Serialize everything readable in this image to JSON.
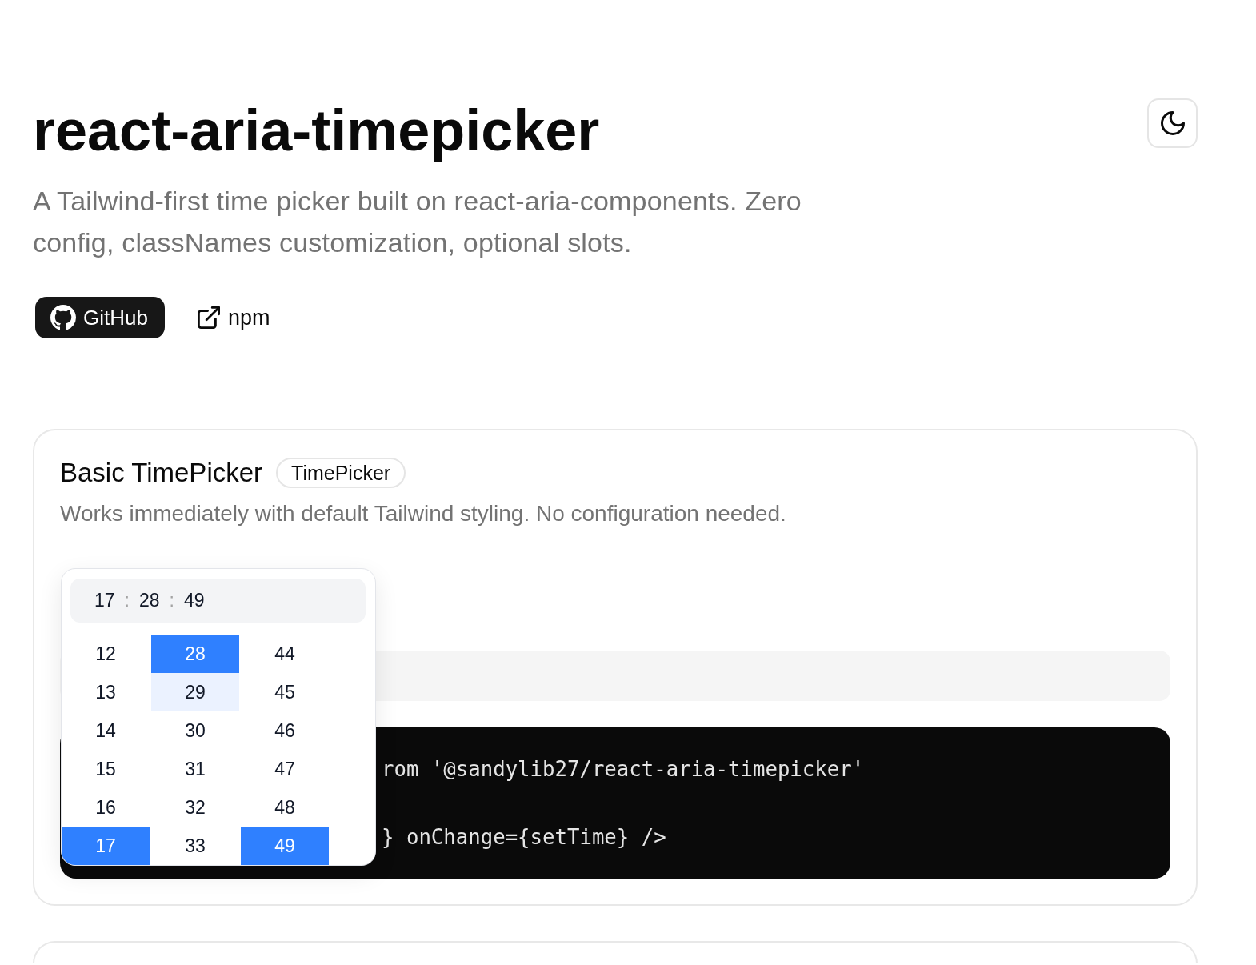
{
  "header": {
    "title": "react-aria-timepicker",
    "description": "A Tailwind-first time picker built on react-aria-components. Zero config, classNames customization, optional slots.",
    "links": [
      {
        "kind": "primary",
        "label": "GitHub"
      },
      {
        "kind": "external",
        "label": "npm"
      }
    ]
  },
  "demos": [
    {
      "title": "Basic TimePicker",
      "badge": "TimePicker",
      "description": "Works immediately with default Tailwind styling. No configuration needed.",
      "time_picker": {
        "segments": [
          {
            "kind": "value",
            "text": "17"
          },
          {
            "kind": "separator",
            "text": ":"
          },
          {
            "kind": "value",
            "text": "28"
          },
          {
            "kind": "separator",
            "text": ":"
          },
          {
            "kind": "value",
            "text": "49"
          }
        ],
        "columns": [
          {
            "items": [
              {
                "label": "12",
                "selected": false,
                "hovered": false
              },
              {
                "label": "13",
                "selected": false,
                "hovered": false
              },
              {
                "label": "14",
                "selected": false,
                "hovered": false
              },
              {
                "label": "15",
                "selected": false,
                "hovered": false
              },
              {
                "label": "16",
                "selected": false,
                "hovered": false
              },
              {
                "label": "17",
                "selected": true,
                "hovered": false
              }
            ]
          },
          {
            "items": [
              {
                "label": "28",
                "selected": true,
                "hovered": false
              },
              {
                "label": "29",
                "selected": false,
                "hovered": true
              },
              {
                "label": "30",
                "selected": false,
                "hovered": false
              },
              {
                "label": "31",
                "selected": false,
                "hovered": false
              },
              {
                "label": "32",
                "selected": false,
                "hovered": false
              },
              {
                "label": "33",
                "selected": false,
                "hovered": false
              }
            ]
          },
          {
            "items": [
              {
                "label": "44",
                "selected": false,
                "hovered": false
              },
              {
                "label": "45",
                "selected": false,
                "hovered": false
              },
              {
                "label": "46",
                "selected": false,
                "hovered": false
              },
              {
                "label": "47",
                "selected": false,
                "hovered": false
              },
              {
                "label": "48",
                "selected": false,
                "hovered": false
              },
              {
                "label": "49",
                "selected": true,
                "hovered": false
              }
            ]
          }
        ]
      },
      "code_lines": [
        "rom '@sandylib27/react-aria-timepicker'",
        "} onChange={setTime} />"
      ]
    }
  ]
}
